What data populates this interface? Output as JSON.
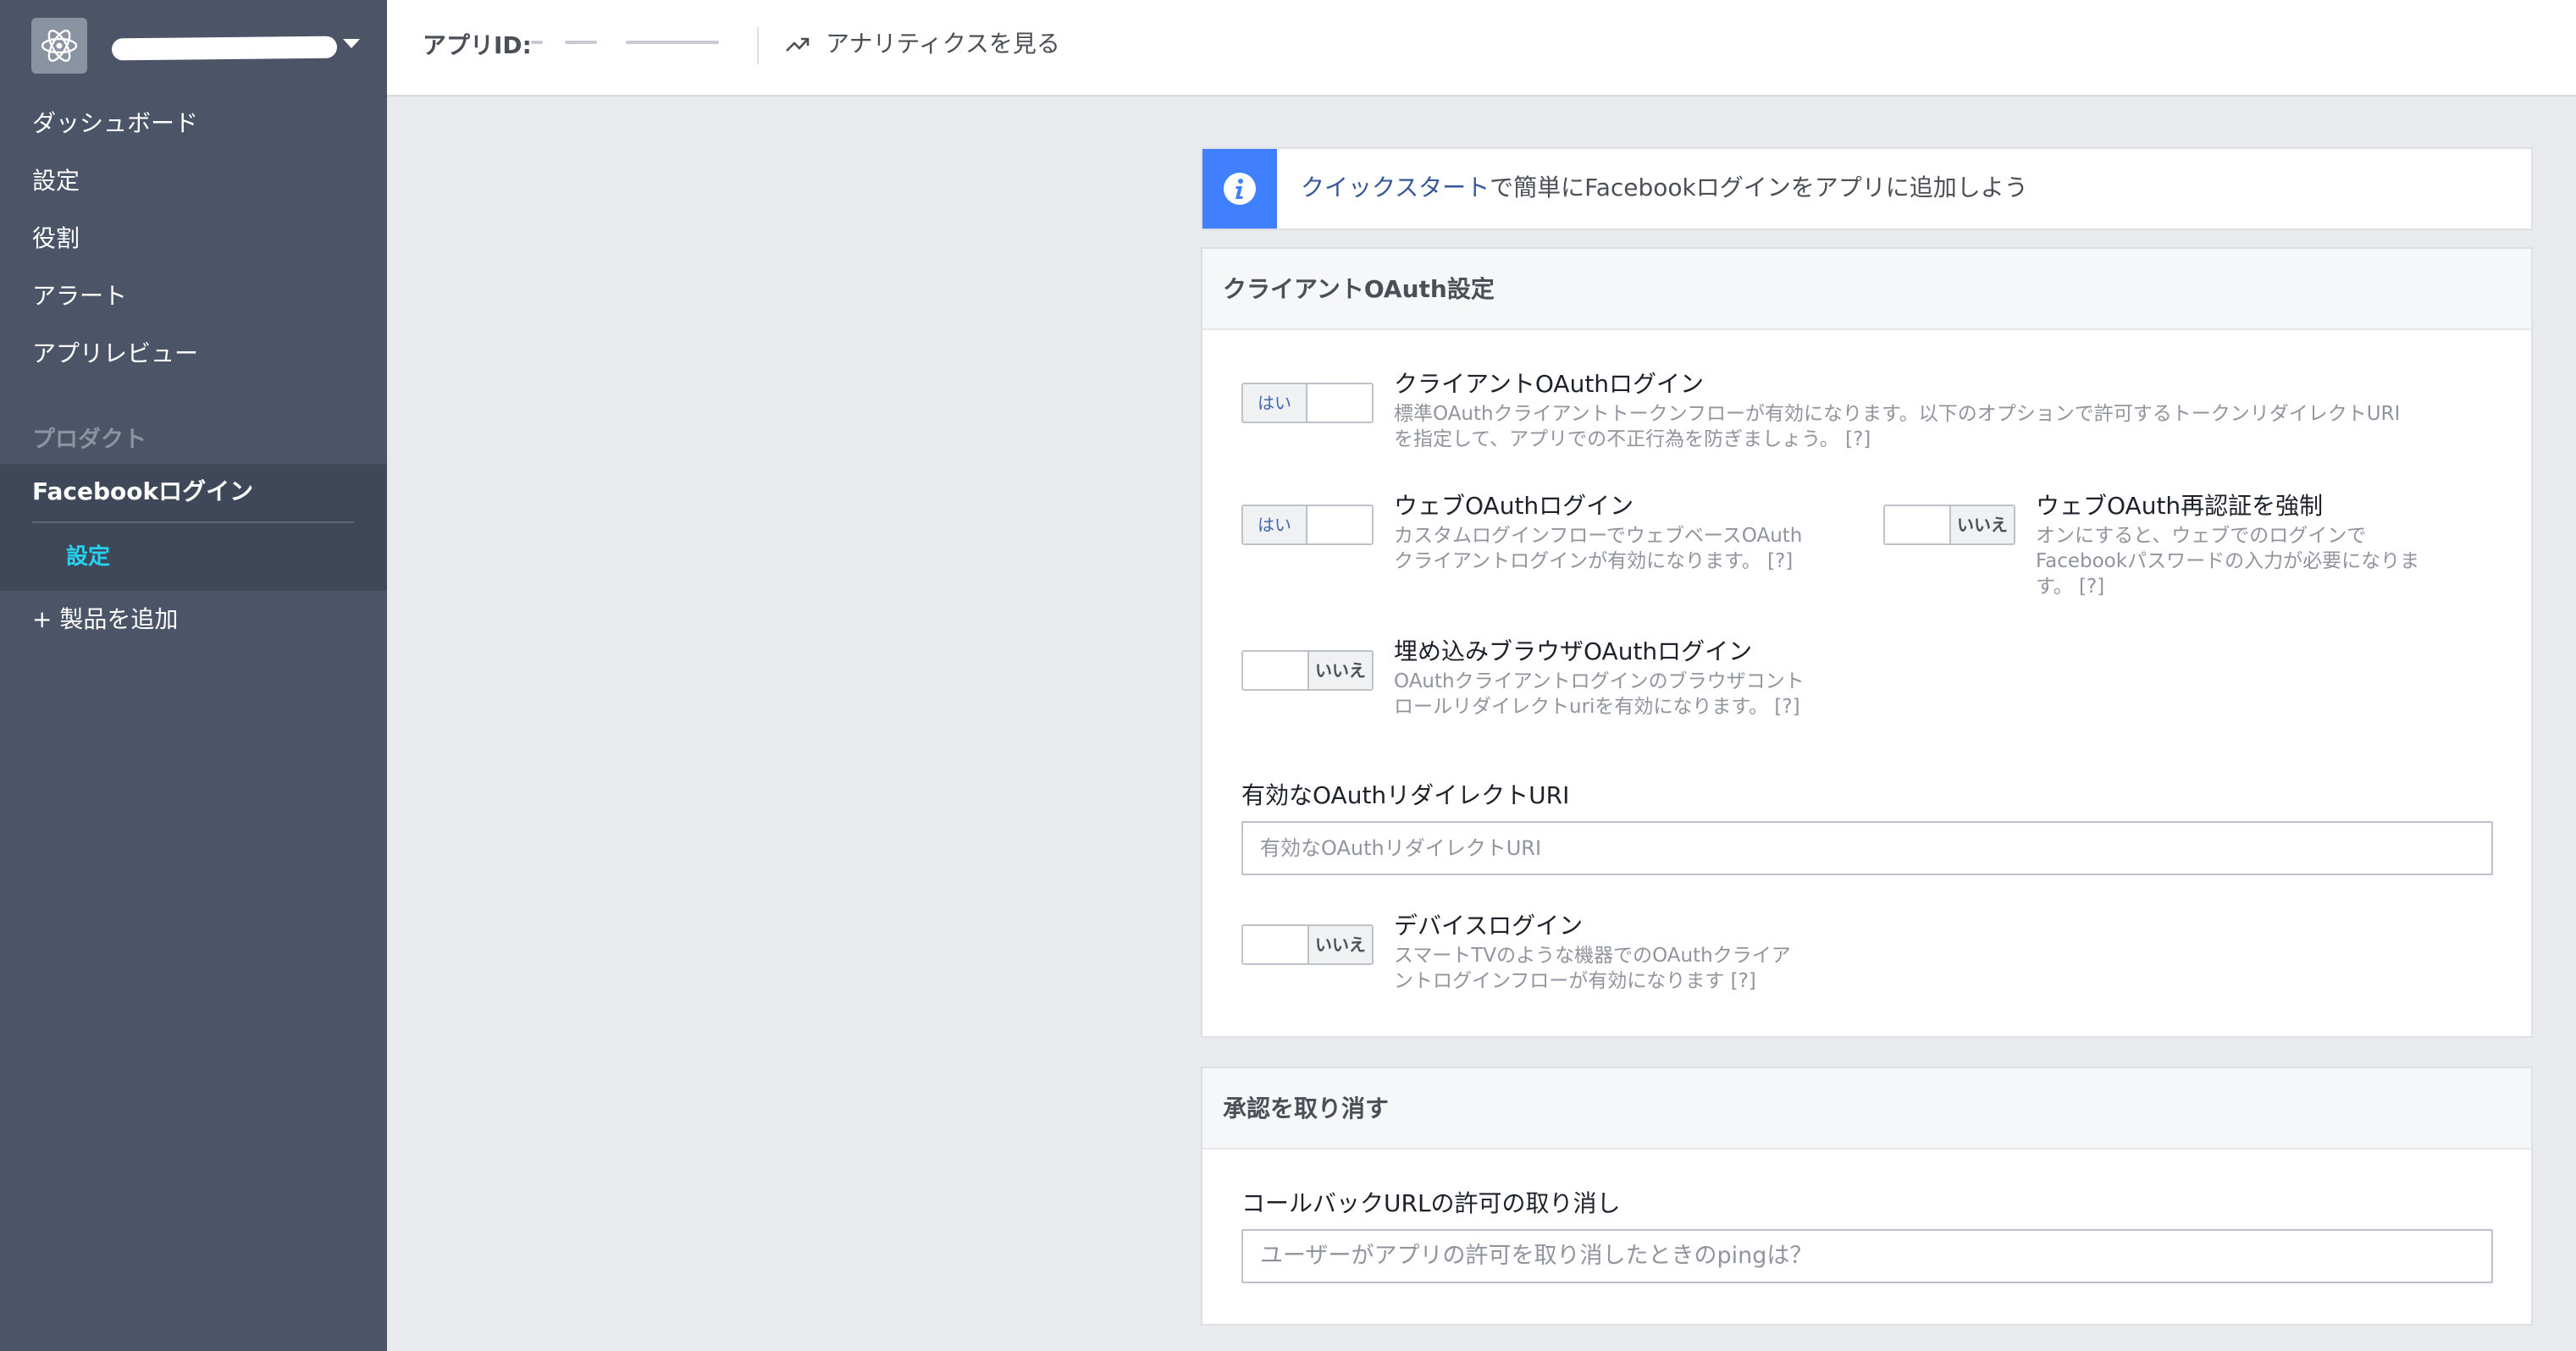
{
  "sidebar": {
    "nav": [
      "ダッシュボード",
      "設定",
      "役割",
      "アラート",
      "アプリレビュー"
    ],
    "section_label": "プロダクト",
    "active_product": "Facebookログイン",
    "active_sub": "設定",
    "add_product": "+ 製品を追加"
  },
  "topbar": {
    "app_id_label": "アプリID:",
    "analytics_label": "アナリティクスを見る"
  },
  "info": {
    "link_text": "クイックスタート",
    "rest_text": "で簡単にFacebookログインをアプリに追加しよう"
  },
  "oauth": {
    "title": "クライアントOAuth設定",
    "toggle_on": "はい",
    "toggle_off": "いいえ",
    "client_login": {
      "title": "クライアントOAuthログイン",
      "desc": "標準OAuthクライアントトークンフローが有効になります。以下のオプションで許可するトークンリダイレクトURIを指定して、アプリでの不正行為を防ぎましょう。 [?]",
      "state": "on"
    },
    "web_login": {
      "title": "ウェブOAuthログイン",
      "desc": "カスタムログインフローでウェブベースOAuthクライアントログインが有効になります。 [?]",
      "state": "on"
    },
    "web_reauth": {
      "title": "ウェブOAuth再認証を強制",
      "desc": "オンにすると、ウェブでのログインでFacebookパスワードの入力が必要になります。 [?]",
      "state": "off"
    },
    "embedded_login": {
      "title": "埋め込みブラウザOAuthログイン",
      "desc": "OAuthクライアントログインのブラウザコントロールリダイレクトuriを有効になります。 [?]",
      "state": "off"
    },
    "redirect_uri": {
      "label": "有効なOAuthリダイレクトURI",
      "placeholder": "有効なOAuthリダイレクトURI",
      "value": ""
    },
    "device_login": {
      "title": "デバイスログイン",
      "desc": "スマートTVのような機器でのOAuthクライアントログインフローが有効になります [?]",
      "state": "off"
    }
  },
  "revoke": {
    "title": "承認を取り消す",
    "callback_label": "コールバックURLの許可の取り消し",
    "callback_placeholder": "ユーザーがアプリの許可を取り消したときのpingは？",
    "callback_value": ""
  },
  "colors": {
    "sidebar_bg": "#4b5567",
    "sidebar_active_bg": "#3f4859",
    "active_sub": "#27d1f0",
    "info_accent": "#4080ff",
    "link": "#365899"
  }
}
